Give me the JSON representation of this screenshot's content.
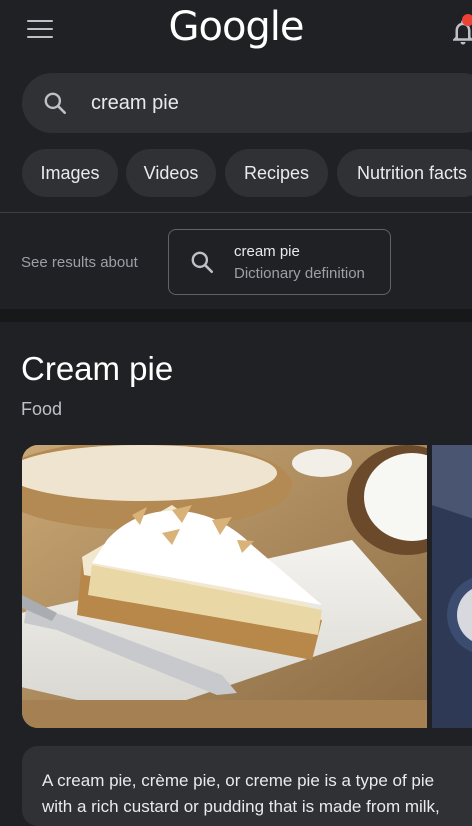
{
  "header": {
    "logo_text": "Google",
    "menu_icon": "hamburger-menu-icon",
    "notification_icon": "bell-icon"
  },
  "search": {
    "query": "cream pie",
    "icon": "search-icon"
  },
  "chips": [
    {
      "label": "Images"
    },
    {
      "label": "Videos"
    },
    {
      "label": "Recipes"
    },
    {
      "label": "Nutrition facts"
    }
  ],
  "see_results": {
    "label": "See results about",
    "card_title": "cream pie",
    "card_subtitle": "Dictionary definition"
  },
  "knowledge_panel": {
    "title": "Cream pie",
    "subtitle": "Food",
    "description_line1": "A cream pie, crème pie, or creme pie is a type of pie",
    "description_line2": "with a rich custard or pudding that is made from milk,"
  },
  "colors": {
    "background": "#202124",
    "surface": "#303134",
    "text": "#e8eaed",
    "muted": "#9aa0a6",
    "badge": "#ea4335"
  }
}
